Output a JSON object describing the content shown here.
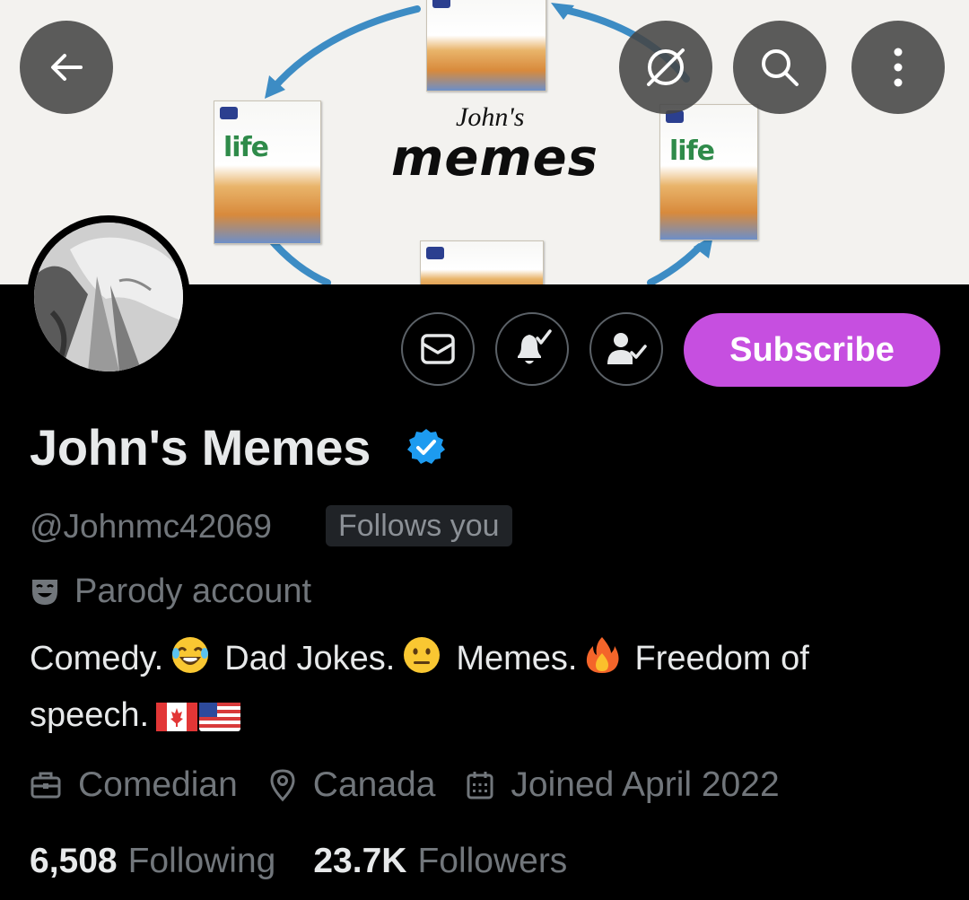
{
  "banner": {
    "title_small": "John's",
    "title_large": "memes",
    "cereal_brand": "life"
  },
  "top_bar": {
    "back_icon": "arrow-left-icon",
    "hide_icon": "no-symbol-icon",
    "search_icon": "search-icon",
    "more_icon": "more-vertical-icon"
  },
  "actions": {
    "message_icon": "envelope-icon",
    "notify_icon": "bell-check-icon",
    "following_icon": "person-check-icon",
    "subscribe_label": "Subscribe",
    "subscribe_color": "#c64fe0"
  },
  "profile": {
    "display_name": "John's Memes",
    "verified_color": "#1d9bf0",
    "handle": "@Johnmc42069",
    "follows_you": "Follows you",
    "parody_label": "Parody account",
    "bio": {
      "part1": "Comedy.",
      "part2": "Dad Jokes.",
      "part3": "Memes.",
      "part4": "Freedom of",
      "part5": "speech."
    },
    "meta": {
      "profession": "Comedian",
      "location": "Canada",
      "joined": "Joined April 2022"
    },
    "stats": {
      "following_count": "6,508",
      "following_label": "Following",
      "followers_count": "23.7K",
      "followers_label": "Followers"
    }
  },
  "colors": {
    "background": "#000000",
    "text_primary": "#e7e9ea",
    "text_secondary": "#71767b"
  }
}
